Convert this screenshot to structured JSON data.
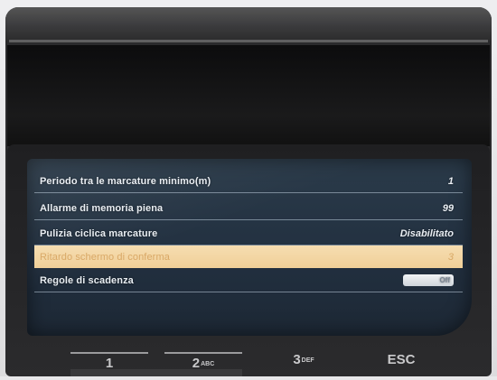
{
  "menu": {
    "rows": [
      {
        "label": "Periodo tra le marcature minimo(m)",
        "value": "1"
      },
      {
        "label": "Allarme di memoria piena",
        "value": "99"
      },
      {
        "label": "Pulizia ciclica marcature",
        "value": "Disabilitato"
      },
      {
        "label": "Ritardo schermo di conferma",
        "value": "3",
        "selected": true
      },
      {
        "label": "Regole di scadenza",
        "value": "Off"
      }
    ],
    "selected_index": 3,
    "colors": {
      "screen_bg": "#223040",
      "highlight_bg": "#f3d6a4",
      "highlight_text": "#d9a866",
      "text": "#e9eef3"
    }
  },
  "keypad": {
    "keys": [
      {
        "main": "1",
        "sub": ""
      },
      {
        "main": "2",
        "sub": "ABC"
      },
      {
        "main": "3",
        "sub": "DEF"
      },
      {
        "main": "ESC",
        "sub": ""
      }
    ]
  }
}
